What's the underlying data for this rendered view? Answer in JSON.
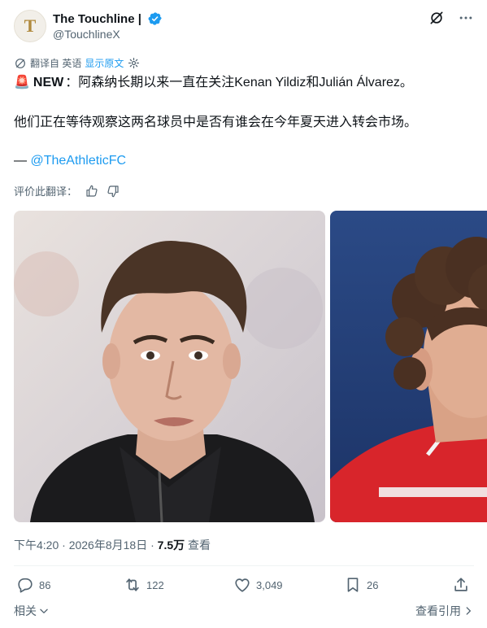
{
  "author": {
    "avatar_letter": "T",
    "display_name": "The Touchline |",
    "handle": "@TouchlineX"
  },
  "translation": {
    "translated_from": "翻译自 英语",
    "show_original": "显示原文"
  },
  "tweet": {
    "siren_emoji": "🚨",
    "new_label": "NEW",
    "line1_rest": "：阿森纳长期以来一直在关注Kenan Yildiz和Julián Álvarez。",
    "line2": "他们正在等待观察这两名球员中是否有谁会在今年夏天进入转会市场。",
    "credit_dash": "— ",
    "credit_mention": "@TheAthleticFC"
  },
  "rate_translation": "评价此翻译：",
  "meta": {
    "time": "下午4:20",
    "separator": " · ",
    "date": "2026年8月18日",
    "views_count": "7.5万",
    "views_label": " 查看"
  },
  "actions": {
    "replies": "86",
    "reposts": "122",
    "likes": "3,049",
    "bookmarks": "26"
  },
  "footer": {
    "related": "相关",
    "view_quotes": "查看引用"
  },
  "colors": {
    "accent": "#1d9bf0",
    "text": "#0f1419",
    "muted": "#536471"
  }
}
